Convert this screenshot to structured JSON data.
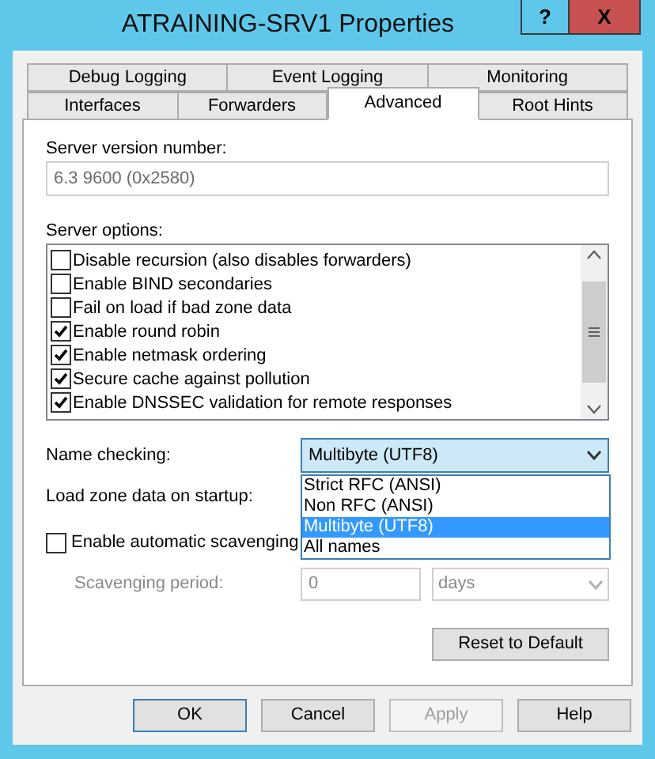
{
  "window": {
    "title": "ATRAINING-SRV1 Properties",
    "help_glyph": "?",
    "close_glyph": "X"
  },
  "tab_rows": [
    [
      {
        "label": "Debug Logging",
        "selected": false
      },
      {
        "label": "Event Logging",
        "selected": false
      },
      {
        "label": "Monitoring",
        "selected": false
      }
    ],
    [
      {
        "label": "Interfaces",
        "selected": false
      },
      {
        "label": "Forwarders",
        "selected": false
      },
      {
        "label": "Advanced",
        "selected": true
      },
      {
        "label": "Root Hints",
        "selected": false
      }
    ]
  ],
  "server_version": {
    "label": "Server version number:",
    "value": "6.3 9600 (0x2580)"
  },
  "server_options": {
    "label": "Server options:",
    "items": [
      {
        "label": "Disable recursion (also disables forwarders)",
        "checked": false
      },
      {
        "label": "Enable BIND secondaries",
        "checked": false
      },
      {
        "label": "Fail on load if bad zone data",
        "checked": false
      },
      {
        "label": "Enable round robin",
        "checked": true
      },
      {
        "label": "Enable netmask ordering",
        "checked": true
      },
      {
        "label": "Secure cache against pollution",
        "checked": true
      },
      {
        "label": "Enable DNSSEC validation for remote responses",
        "checked": true
      }
    ]
  },
  "name_checking": {
    "label": "Name checking:",
    "value": "Multibyte (UTF8)",
    "expanded": true,
    "options": [
      {
        "label": "Strict RFC (ANSI)",
        "selected": false
      },
      {
        "label": "Non RFC (ANSI)",
        "selected": false
      },
      {
        "label": "Multibyte (UTF8)",
        "selected": true
      },
      {
        "label": "All names",
        "selected": false
      }
    ]
  },
  "load_zone": {
    "label": "Load zone data on startup:"
  },
  "scavenging": {
    "label": "Enable automatic scavenging",
    "checked": false
  },
  "scavenging_period": {
    "label": "Scavenging period:",
    "value": "0",
    "unit": "days",
    "disabled": true
  },
  "reset_button": "Reset to Default",
  "buttons": [
    {
      "label": "OK",
      "disabled": false,
      "default": true
    },
    {
      "label": "Cancel",
      "disabled": false,
      "default": false
    },
    {
      "label": "Apply",
      "disabled": true,
      "default": false
    },
    {
      "label": "Help",
      "disabled": false,
      "default": false
    }
  ]
}
